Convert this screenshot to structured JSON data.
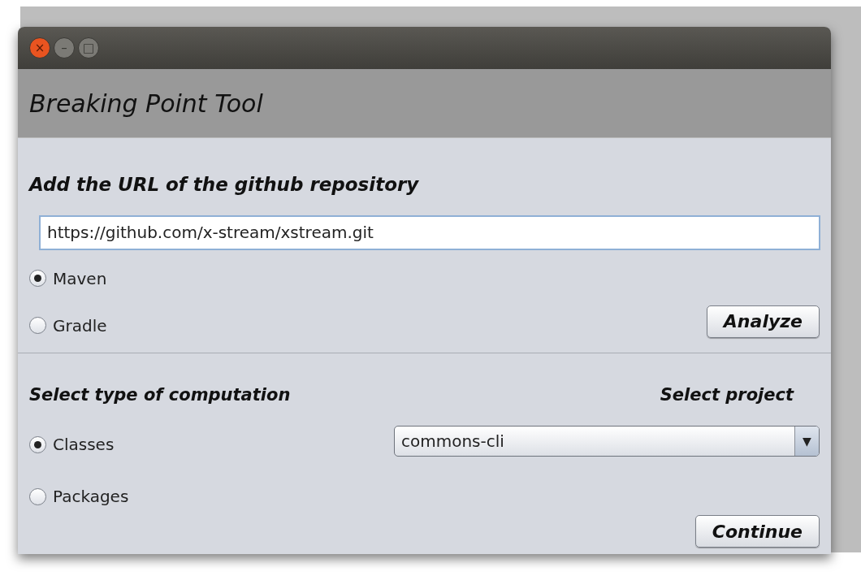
{
  "window": {
    "title": "Breaking Point Tool",
    "controls": [
      {
        "kind": "close",
        "label": "×"
      },
      {
        "kind": "minimize",
        "label": "–"
      },
      {
        "kind": "maximize",
        "label": "□"
      }
    ]
  },
  "repository": {
    "heading": "Add the URL of the github repository",
    "url": "https://github.com/x-stream/xstream.git",
    "build_tools": [
      {
        "label": "Maven",
        "selected": true
      },
      {
        "label": "Gradle",
        "selected": false
      }
    ],
    "button": "Analyze"
  },
  "computation": {
    "heading": "Select type of computation",
    "types": [
      {
        "label": "Classes",
        "selected": true
      },
      {
        "label": "Packages",
        "selected": false
      }
    ]
  },
  "project": {
    "heading": "Select project",
    "value": "commons-cli",
    "arrow": "▼"
  },
  "continue_button": "Continue"
}
